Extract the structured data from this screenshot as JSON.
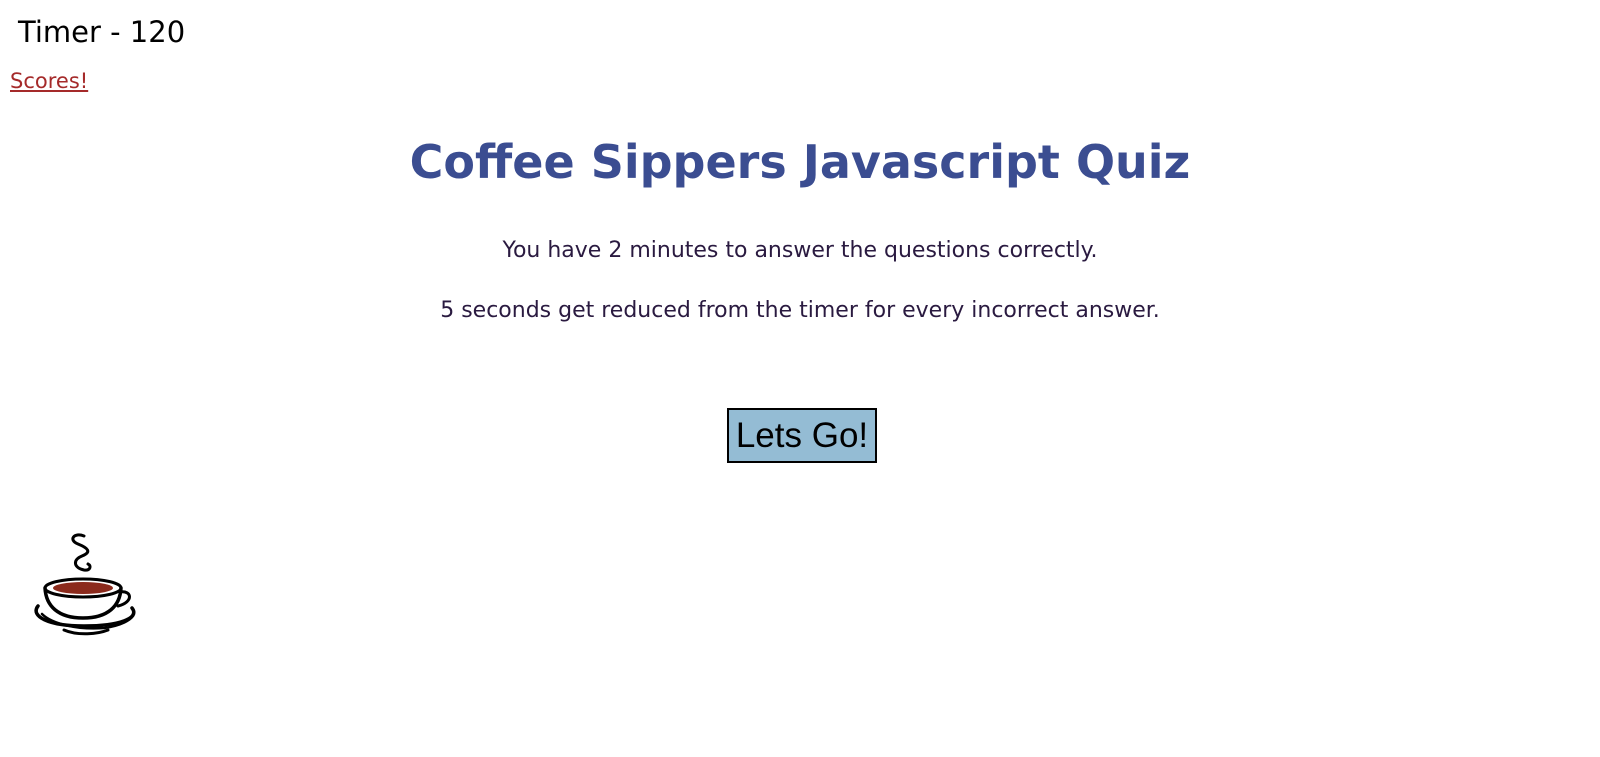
{
  "header": {
    "timer_text": "Timer - 120",
    "scores_link": "Scores!"
  },
  "quiz": {
    "title": "Coffee Sippers Javascript Quiz",
    "instructions": [
      "You have 2 minutes to answer the questions correctly.",
      "5 seconds get reduced from the timer for every incorrect answer."
    ],
    "start_button": "Lets Go!"
  },
  "icons": {
    "logo": "coffee-cup-icon"
  },
  "colors": {
    "title": "#3b4d91",
    "link": "#a52a2a",
    "button_bg": "#94bcd4",
    "instruction_text": "#2a1a40",
    "coffee": "#8b2a1c"
  }
}
